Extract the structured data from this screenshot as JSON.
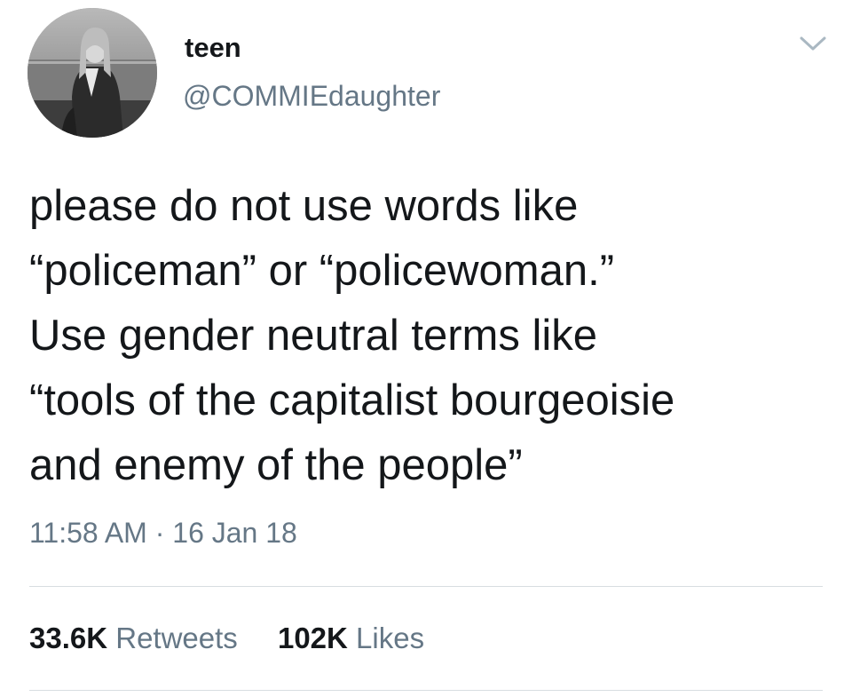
{
  "tweet": {
    "display_name": "teen",
    "handle": "@COMMIEdaughter",
    "text_lines": [
      "please do not use words like",
      "“policeman” or “policewoman.”",
      "Use gender neutral terms like",
      "“tools of the capitalist bourgeoisie",
      "and enemy of the people”"
    ],
    "timestamp": "11:58 AM · 16 Jan 18",
    "stats": {
      "retweets_count": "33.6K",
      "retweets_label": "Retweets",
      "likes_count": "102K",
      "likes_label": "Likes"
    },
    "icons": {
      "menu": "chevron-down-icon",
      "avatar": "avatar-photo"
    }
  }
}
